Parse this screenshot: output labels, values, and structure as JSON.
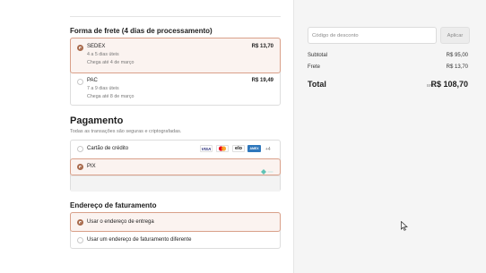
{
  "shipping": {
    "title": "Forma de frete (4 dias de processamento)",
    "options": [
      {
        "name": "SEDEX",
        "days": "4 a 5 dias úteis",
        "arrival": "Chega até 4 de março",
        "price": "R$ 13,70",
        "selected": true
      },
      {
        "name": "PAC",
        "days": "7 a 9 dias úteis",
        "arrival": "Chega até 8 de março",
        "price": "R$ 19,49",
        "selected": false
      }
    ]
  },
  "payment": {
    "title": "Pagamento",
    "subtitle": "Todas as transações são seguras e criptografadas.",
    "options": [
      {
        "label": "Cartão de crédito",
        "selected": false,
        "card_icons": [
          "visa-icon",
          "mastercard-icon",
          "elo-icon",
          "amex-icon"
        ],
        "cards": {
          "visa": "VISA",
          "elo": "elo",
          "amex": "AMEX"
        },
        "more": "+4"
      },
      {
        "label": "PIX",
        "selected": true,
        "icon": "pix-icon"
      }
    ]
  },
  "billing": {
    "title": "Endereço de faturamento",
    "options": [
      {
        "label": "Usar o endereço de entrega",
        "selected": true
      },
      {
        "label": "Usar um endereço de faturamento diferente",
        "selected": false
      }
    ]
  },
  "summary": {
    "discount_placeholder": "Código de desconto",
    "apply_label": "Aplicar",
    "subtotal_label": "Subtotal",
    "subtotal_value": "R$ 95,00",
    "shipping_label": "Frete",
    "shipping_value": "R$ 13,70",
    "total_label": "Total",
    "total_currency": "BRL",
    "total_value": "R$ 108,70"
  },
  "colors": {
    "accent": "#a86a4c",
    "selected_bg": "#fbf3f0",
    "selected_border": "#d9a089",
    "sidebar_bg": "#f5f5f5"
  }
}
